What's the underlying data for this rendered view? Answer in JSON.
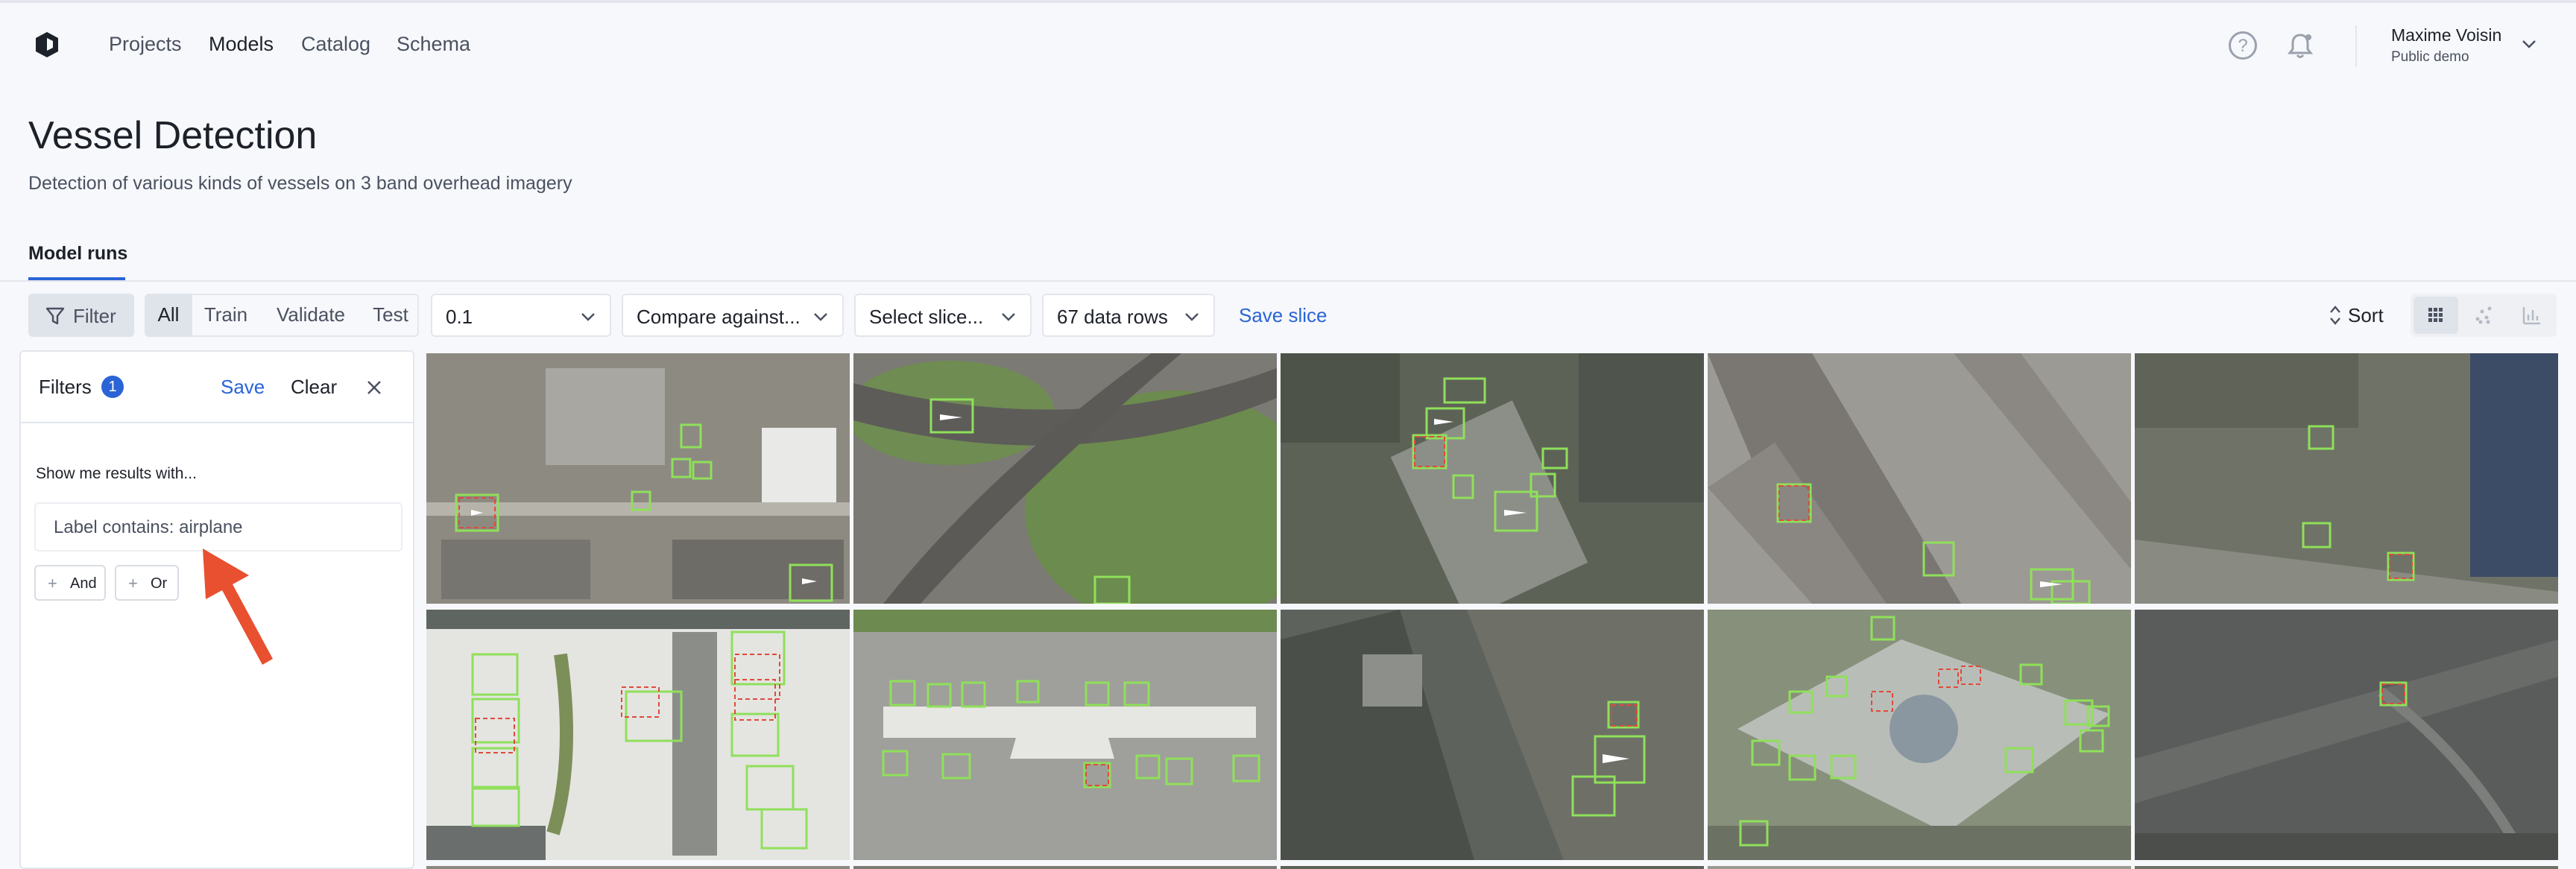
{
  "nav": {
    "links": [
      "Projects",
      "Models",
      "Catalog",
      "Schema"
    ],
    "active": "Models",
    "user_name": "Maxime Voisin",
    "user_sub": "Public demo"
  },
  "header": {
    "title": "Vessel Detection",
    "description": "Detection of various kinds of vessels on 3 band overhead imagery",
    "tab": "Model runs"
  },
  "toolbar": {
    "filter_label": "Filter",
    "segments": [
      "All",
      "Train",
      "Validate",
      "Test"
    ],
    "threshold": "0.1",
    "compare": "Compare against...",
    "slice": "Select slice...",
    "rows": "67 data rows",
    "save_slice": "Save slice",
    "sort": "Sort"
  },
  "filters": {
    "title": "Filters",
    "count": "1",
    "save": "Save",
    "clear": "Clear",
    "show_me": "Show me results with...",
    "chip": "Label contains: airplane",
    "and": "And",
    "or": "Or"
  },
  "colors": {
    "accent": "#2a64d6",
    "arrow": "#e8502f",
    "box_green": "#8fe05a",
    "box_red": "#e04a3a"
  }
}
